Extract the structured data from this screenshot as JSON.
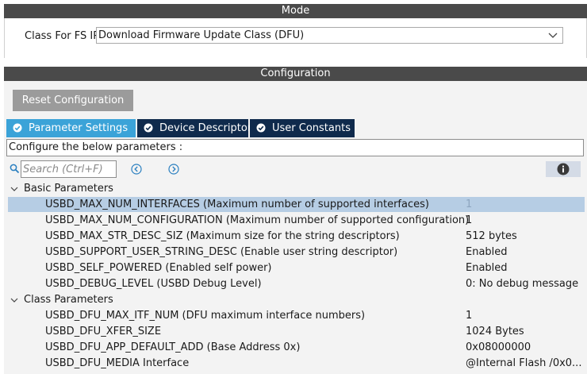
{
  "mode": {
    "header": "Mode",
    "class_label": "Class For FS IP",
    "class_value": "Download Firmware Update Class (DFU)"
  },
  "configuration": {
    "header": "Configuration",
    "reset_button": "Reset Configuration",
    "tabs": [
      {
        "label": "Parameter Settings",
        "active": true
      },
      {
        "label": "Device Descriptor",
        "active": false
      },
      {
        "label": "User Constants",
        "active": false
      }
    ],
    "hint": "Configure the below parameters :",
    "search_placeholder": "Search (Ctrl+F)",
    "groups": [
      {
        "label": "Basic Parameters",
        "expanded": true,
        "params": [
          {
            "name": "USBD_MAX_NUM_INTERFACES (Maximum number of supported interfaces)",
            "value": "1",
            "selected": true
          },
          {
            "name": "USBD_MAX_NUM_CONFIGURATION (Maximum number of supported configuration)",
            "value": "1",
            "selected": false
          },
          {
            "name": "USBD_MAX_STR_DESC_SIZ (Maximum size for the string descriptors)",
            "value": "512 bytes",
            "selected": false
          },
          {
            "name": "USBD_SUPPORT_USER_STRING_DESC (Enable user string descriptor)",
            "value": "Enabled",
            "selected": false
          },
          {
            "name": "USBD_SELF_POWERED (Enabled self power)",
            "value": "Enabled",
            "selected": false
          },
          {
            "name": "USBD_DEBUG_LEVEL (USBD Debug Level)",
            "value": "0: No debug message",
            "selected": false
          }
        ]
      },
      {
        "label": "Class Parameters",
        "expanded": true,
        "params": [
          {
            "name": "USBD_DFU_MAX_ITF_NUM (DFU maximum interface numbers)",
            "value": "1",
            "selected": false
          },
          {
            "name": "USBD_DFU_XFER_SIZE",
            "value": "1024 Bytes",
            "selected": false
          },
          {
            "name": "USBD_DFU_APP_DEFAULT_ADD (Base Address 0x)",
            "value": "0x08000000",
            "selected": false
          },
          {
            "name": "USBD_DFU_MEDIA Interface",
            "value": "@Internal Flash   /0x0...",
            "selected": false
          }
        ]
      }
    ]
  },
  "icons": {
    "search": "search-icon",
    "prev": "arrow-left-circle-icon",
    "next": "arrow-right-circle-icon",
    "info": "info-icon",
    "tab_check": "check-circle-icon",
    "caret": "chevron-down-icon"
  },
  "colors": {
    "section_header_bg": "#4a4a4a",
    "active_tab": "#3ba3d8",
    "inactive_tab": "#0f2a4c",
    "selected_row": "#b6cde4",
    "reset_button": "#9b9b9b"
  }
}
